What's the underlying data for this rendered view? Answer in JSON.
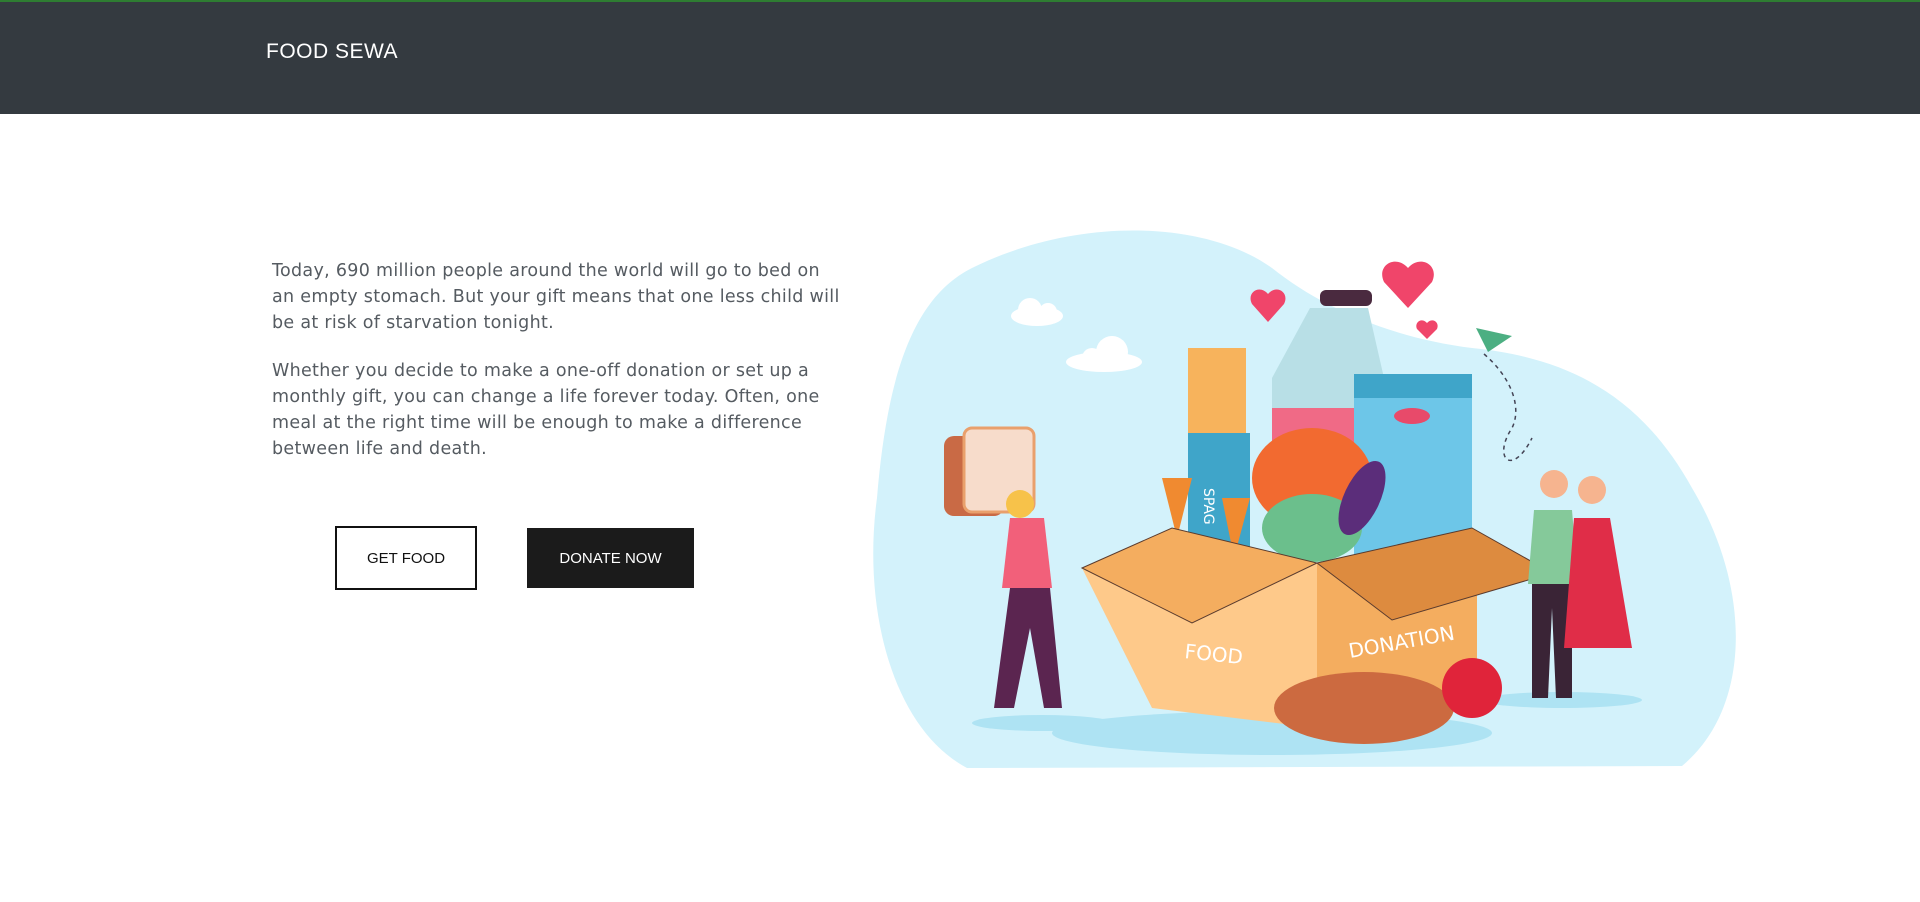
{
  "navbar": {
    "brand": "FOOD SEWA"
  },
  "hero": {
    "paragraphs": [
      "Today, 690 million people around the world will go to bed on an empty stomach. But your gift means that one less child will be at risk of starvation tonight.",
      "Whether you decide to make a one-off donation or set up a monthly gift, you can change a life forever today. Often, one meal at the right time will be enough to make a difference between life and death."
    ],
    "buttons": {
      "get_food": "GET FOOD",
      "donate_now": "DONATE NOW"
    }
  },
  "illustration": {
    "box_labels": {
      "left": "FOOD",
      "right": "DONATION"
    },
    "pasta_label": "SPAG"
  },
  "colors": {
    "navbar": "#343a40",
    "accent_line": "#2e7d32",
    "blob": "#d3f2fb",
    "button_dark": "#1b1b1b"
  }
}
